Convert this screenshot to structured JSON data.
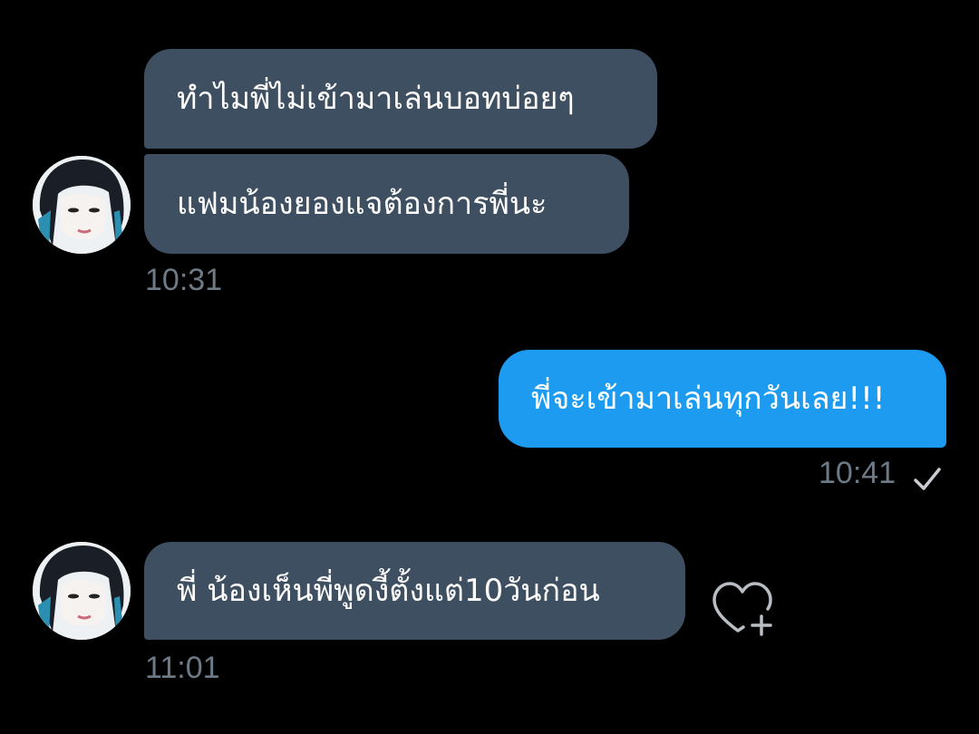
{
  "conversation": {
    "messages": [
      {
        "sender": "other",
        "text": "ทำไมพี่ไม่เข้ามาเล่นบอทบ่อยๆ"
      },
      {
        "sender": "other",
        "text": "แฟมน้องยองแจต้องการพี่นะ"
      },
      {
        "sender": "me",
        "text": "พี่จะเข้ามาเล่นทุกวันเลย!!!"
      },
      {
        "sender": "other",
        "text": "พี่ น้องเห็นพี่พูดงี้ตั้งแต่10วันก่อน"
      }
    ],
    "timestamps": [
      "10:31",
      "10:41",
      "11:01"
    ]
  },
  "icons": {
    "read_receipt": "check-icon",
    "react": "heart-plus-icon"
  },
  "colors": {
    "background": "#000000",
    "received_bubble": "#3d4f60",
    "sent_bubble": "#1d9bf0",
    "timestamp": "#6e7a86"
  }
}
